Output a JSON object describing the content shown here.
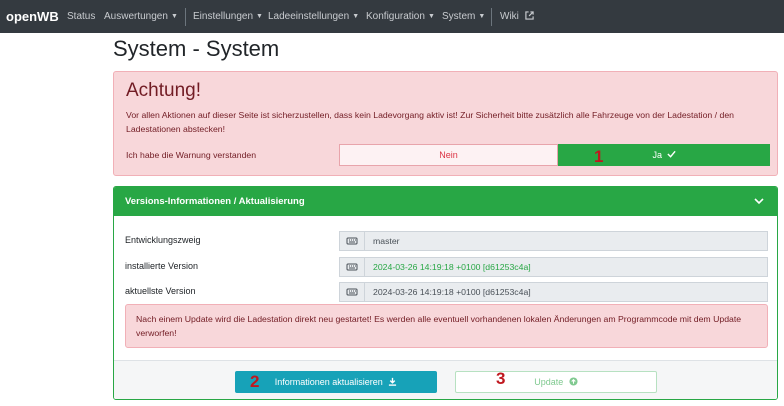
{
  "navbar": {
    "brand": "openWB",
    "items": [
      {
        "label": "Status"
      },
      {
        "label": "Auswertungen"
      },
      {
        "label": "Einstellungen"
      },
      {
        "label": "Ladeeinstellungen"
      },
      {
        "label": "Konfiguration"
      },
      {
        "label": "System"
      },
      {
        "label": "Wiki"
      }
    ]
  },
  "page_title": "System - System",
  "warning": {
    "title": "Achtung!",
    "text": "Vor allen Aktionen auf dieser Seite ist sicherzustellen, dass kein Ladevorgang aktiv ist! Zur Sicherheit bitte zusätzlich alle Fahrzeuge von der Ladestation / den Ladestationen abstecken!",
    "confirm_label": "Ich habe die Warnung verstanden",
    "no_label": "Nein",
    "yes_label": "Ja"
  },
  "versions": {
    "header": "Versions-Informationen / Aktualisierung",
    "rows": [
      {
        "label": "Entwicklungszweig",
        "value": "master"
      },
      {
        "label": "installierte Version",
        "value": "2024-03-26 14:19:18 +0100 [d61253c4a]"
      },
      {
        "label": "aktuellste Version",
        "value": "2024-03-26 14:19:18 +0100 [d61253c4a]"
      }
    ],
    "note": "Nach einem Update wird die Ladestation direkt neu gestartet! Es werden alle eventuell vorhandenen lokalen Änderungen am Programmcode mit dem Update verworfen!",
    "refresh_button": "Informationen aktualisieren",
    "update_button": "Update"
  },
  "markers": [
    "1",
    "2",
    "3"
  ],
  "colors": {
    "success": "#28a745",
    "danger": "#dc3545",
    "info": "#17a2b8",
    "navbar": "#343a40",
    "marker": "#c0181f"
  }
}
